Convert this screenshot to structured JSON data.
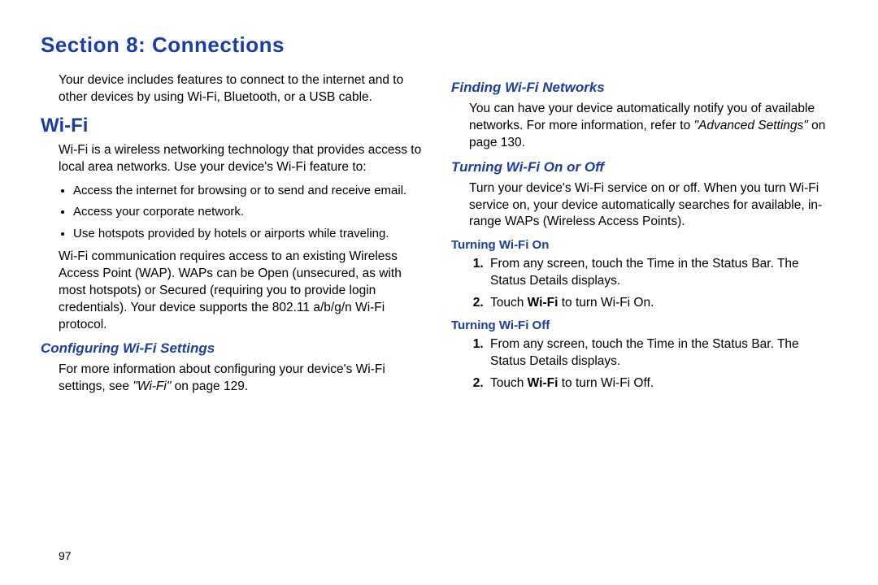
{
  "sectionTitle": "Section 8: Connections",
  "pageNumber": "97",
  "left": {
    "intro": "Your device includes features to connect to the internet and to other devices by using Wi-Fi, Bluetooth, or a USB cable.",
    "h2": "Wi-Fi",
    "wifiIntro": "Wi-Fi is a wireless networking technology that provides access to local area networks. Use your device's Wi-Fi feature to:",
    "bullets": [
      "Access the internet for browsing or to send and receive email.",
      "Access your corporate network.",
      "Use hotspots provided by hotels or airports while traveling."
    ],
    "wifiPara2": "Wi-Fi communication requires access to an existing Wireless Access Point (WAP). WAPs can be Open (unsecured, as with most hotspots) or Secured (requiring you to provide login credentials). Your device supports the 802.11 a/b/g/n Wi-Fi protocol.",
    "h3Config": "Configuring Wi-Fi Settings",
    "configPara_a": "For more information about configuring your device's Wi-Fi settings, see ",
    "configPara_ref": "\"Wi-Fi\"",
    "configPara_b": " on page 129."
  },
  "right": {
    "h3Finding": "Finding Wi-Fi Networks",
    "findingPara_a": "You can have your device automatically notify you of available networks. For more information, refer to ",
    "findingPara_ref": "\"Advanced Settings\"",
    "findingPara_b": " on page 130.",
    "h3OnOff": "Turning Wi-Fi On or Off",
    "onOffPara": "Turn your device's Wi-Fi service on or off. When you turn Wi-Fi service on, your device automatically searches for available, in-range WAPs (Wireless Access Points).",
    "h4On": "Turning Wi-Fi On",
    "stepsOn": {
      "s1": "From any screen, touch the Time in the Status Bar. The Status Details displays.",
      "s2a": "Touch ",
      "s2b": "Wi-Fi",
      "s2c": " to turn Wi-Fi On."
    },
    "h4Off": "Turning Wi-Fi Off",
    "stepsOff": {
      "s1": "From any screen, touch the Time in the Status Bar. The Status Details displays.",
      "s2a": "Touch ",
      "s2b": "Wi-Fi",
      "s2c": " to turn Wi-Fi Off."
    }
  }
}
